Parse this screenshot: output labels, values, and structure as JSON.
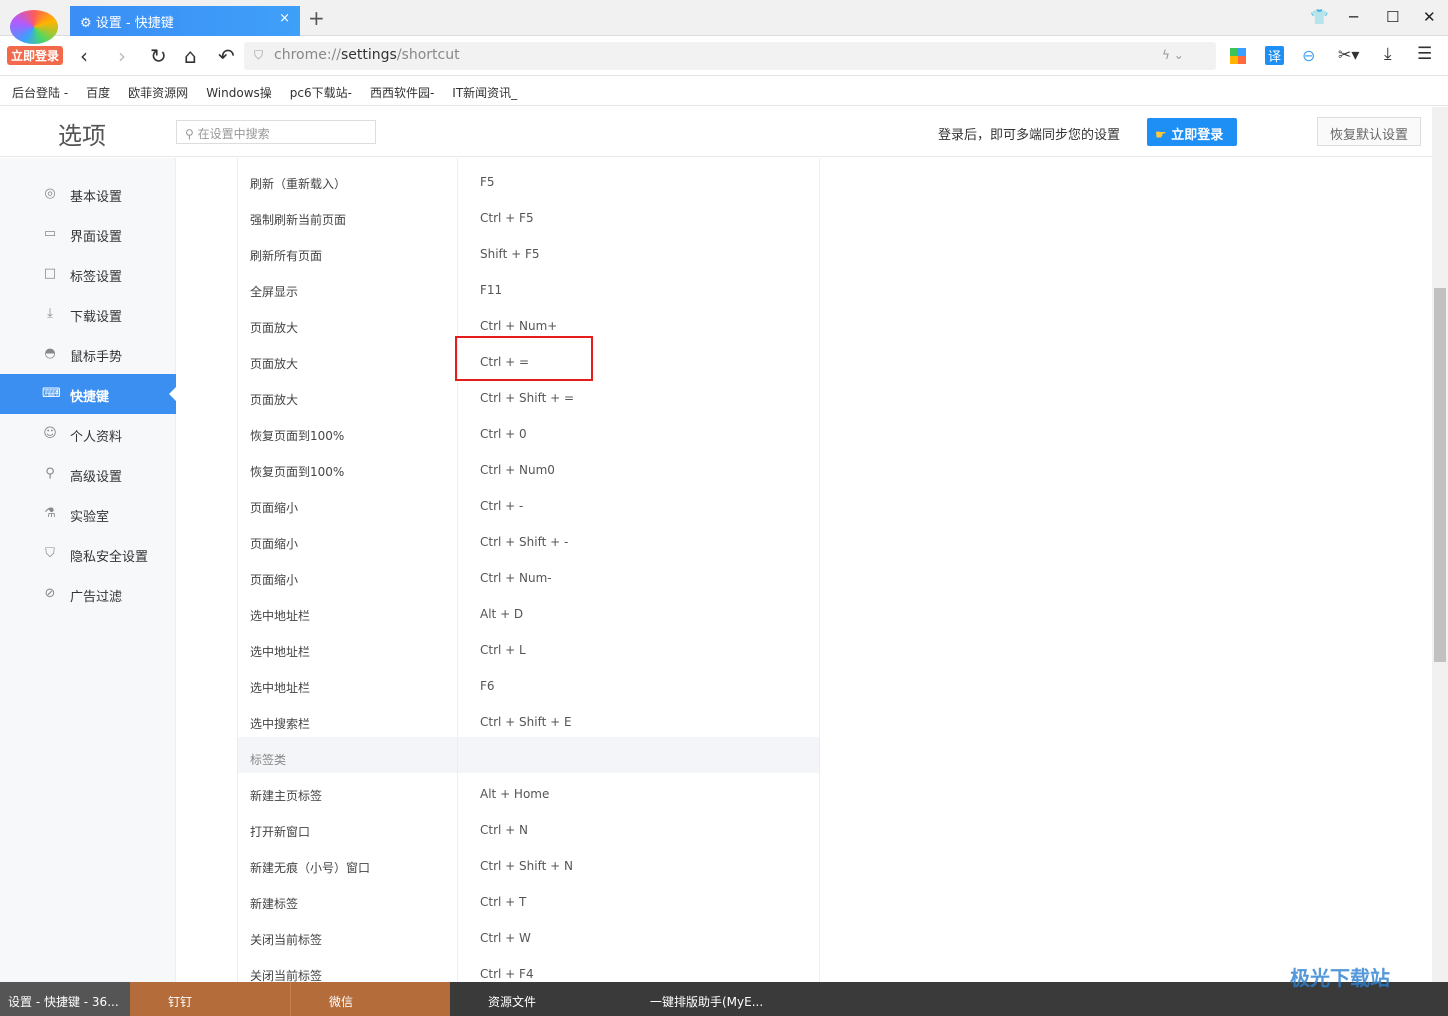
{
  "browser": {
    "tab_title": "设置 - 快捷键",
    "login_badge": "立即登录",
    "url_prefix": "chrome://",
    "url_main": "settings",
    "url_suffix": "/shortcut"
  },
  "bookmarks": [
    "后台登陆 -",
    "百度",
    "欧菲资源网",
    "Windows操",
    "pc6下载站-",
    "西西软件园-",
    "IT新闻资讯_"
  ],
  "header": {
    "title": "选项",
    "search_placeholder": "在设置中搜索",
    "sync_text": "登录后，即可多端同步您的设置",
    "login_button": "立即登录",
    "restore_button": "恢复默认设置"
  },
  "sidebar": {
    "items": [
      {
        "label": "基本设置",
        "icon": "◎"
      },
      {
        "label": "界面设置",
        "icon": "▭"
      },
      {
        "label": "标签设置",
        "icon": "□"
      },
      {
        "label": "下载设置",
        "icon": "⤓"
      },
      {
        "label": "鼠标手势",
        "icon": "◓"
      },
      {
        "label": "快捷键",
        "icon": "⌨",
        "active": true
      },
      {
        "label": "个人资料",
        "icon": "☺"
      },
      {
        "label": "高级设置",
        "icon": "⚲"
      },
      {
        "label": "实验室",
        "icon": "⚗"
      },
      {
        "label": "隐私安全设置",
        "icon": "⛉"
      },
      {
        "label": "广告过滤",
        "icon": "⊘"
      }
    ]
  },
  "shortcuts": [
    [
      "刷新（重新载入）",
      "F5"
    ],
    [
      "强制刷新当前页面",
      "Ctrl + F5"
    ],
    [
      "刷新所有页面",
      "Shift + F5"
    ],
    [
      "全屏显示",
      "F11"
    ],
    [
      "页面放大",
      "Ctrl + Num+"
    ],
    [
      "页面放大",
      "Ctrl + ="
    ],
    [
      "页面放大",
      "Ctrl + Shift + ="
    ],
    [
      "恢复页面到100%",
      "Ctrl + 0"
    ],
    [
      "恢复页面到100%",
      "Ctrl + Num0"
    ],
    [
      "页面缩小",
      "Ctrl + -"
    ],
    [
      "页面缩小",
      "Ctrl + Shift + -"
    ],
    [
      "页面缩小",
      "Ctrl + Num-"
    ],
    [
      "选中地址栏",
      "Alt + D"
    ],
    [
      "选中地址栏",
      "Ctrl + L"
    ],
    [
      "选中地址栏",
      "F6"
    ],
    [
      "选中搜索栏",
      "Ctrl + Shift + E"
    ],
    [
      "标签类",
      ""
    ],
    [
      "新建主页标签",
      "Alt + Home"
    ],
    [
      "打开新窗口",
      "Ctrl + N"
    ],
    [
      "新建无痕（小号）窗口",
      "Ctrl + Shift + N"
    ],
    [
      "新建标签",
      "Ctrl + T"
    ],
    [
      "关闭当前标签",
      "Ctrl + W"
    ],
    [
      "关闭当前标签",
      "Ctrl + F4"
    ]
  ],
  "taskbar": [
    "设置 - 快捷键 - 36...",
    "钉钉",
    "微信",
    "资源文件",
    "一键排版助手(MyE..."
  ],
  "watermark": "极光下载站"
}
